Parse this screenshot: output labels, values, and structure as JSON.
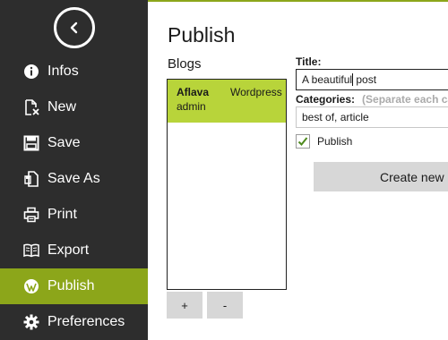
{
  "colors": {
    "accent": "#8ca61a",
    "selection": "#b8d43a",
    "sidebar": "#2d2d2d"
  },
  "sidebar": {
    "back_icon": "back-arrow-icon",
    "items": [
      {
        "label": "Infos",
        "icon": "info-icon"
      },
      {
        "label": "New",
        "icon": "new-document-icon"
      },
      {
        "label": "Save",
        "icon": "save-icon"
      },
      {
        "label": "Save As",
        "icon": "save-as-icon"
      },
      {
        "label": "Print",
        "icon": "print-icon"
      },
      {
        "label": "Export",
        "icon": "export-icon"
      },
      {
        "label": "Publish",
        "icon": "wordpress-icon",
        "active": true
      },
      {
        "label": "Preferences",
        "icon": "gear-icon"
      }
    ]
  },
  "main": {
    "title": "Publish",
    "blogs_label": "Blogs",
    "blogs": [
      {
        "name": "Aflava",
        "engine": "Wordpress",
        "user": "admin",
        "selected": true
      }
    ],
    "add_label": "+",
    "remove_label": "-",
    "title_label": "Title:",
    "title_value_before_caret": "A beautiful",
    "title_value_after_caret": " post",
    "categories_label": "Categories:",
    "categories_hint": "(Separate each cat",
    "categories_value": "best of, article",
    "publish_checkbox": {
      "label": "Publish",
      "checked": true
    },
    "create_button_label": "Create new p"
  }
}
